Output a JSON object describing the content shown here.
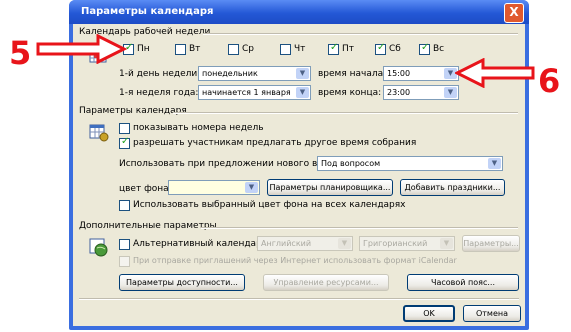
{
  "window": {
    "title": "Параметры календаря",
    "close_glyph": "X"
  },
  "work_week": {
    "section_label": "Календарь рабочей недели",
    "days": [
      {
        "label": "Пн",
        "checked": true
      },
      {
        "label": "Вт",
        "checked": false
      },
      {
        "label": "Ср",
        "checked": false
      },
      {
        "label": "Чт",
        "checked": false
      },
      {
        "label": "Пт",
        "checked": true
      },
      {
        "label": "Сб",
        "checked": true
      },
      {
        "label": "Вс",
        "checked": true
      }
    ],
    "first_day_label": "1-й день недели:",
    "first_day_value": "понедельник",
    "first_week_label": "1-я неделя года:",
    "first_week_value": "начинается 1 января",
    "start_time_label": "время начала:",
    "start_time_value": "15:00",
    "end_time_label": "время конца:",
    "end_time_value": "23:00"
  },
  "calendar_options": {
    "section_label": "Параметры календаря",
    "show_week_numbers": {
      "label": "показывать номера недель",
      "checked": false
    },
    "allow_propose": {
      "label": "разрешать участникам предлагать другое время собрания",
      "checked": true
    },
    "propose_label": "Использовать при предложении нового времени:",
    "propose_value": "Под вопросом",
    "bg_color_label": "цвет фона:",
    "bg_color_value": "",
    "scheduling_button": "Параметры планировщика...",
    "holidays_button": "Добавить праздники...",
    "use_bg_all": {
      "label": "Использовать выбранный цвет фона на всех календарях",
      "checked": false
    }
  },
  "advanced": {
    "section_label": "Дополнительные параметры",
    "alt_calendar": {
      "label": "Альтернативный календарь:",
      "checked": false
    },
    "language_value": "Английский",
    "calendar_type_value": "Григорианский",
    "params_button": "Параметры...",
    "icalendar": {
      "label": "При отправке приглашений через Интернет использовать формат iCalendar",
      "checked": false
    },
    "free_busy_button": "Параметры доступности...",
    "resource_button": "Управление ресурсами...",
    "timezone_button": "Часовой пояс..."
  },
  "footer": {
    "ok_label": "OK",
    "cancel_label": "Отмена"
  },
  "annotations": {
    "left_number": "5",
    "right_number": "6",
    "color": "#e8141a"
  }
}
